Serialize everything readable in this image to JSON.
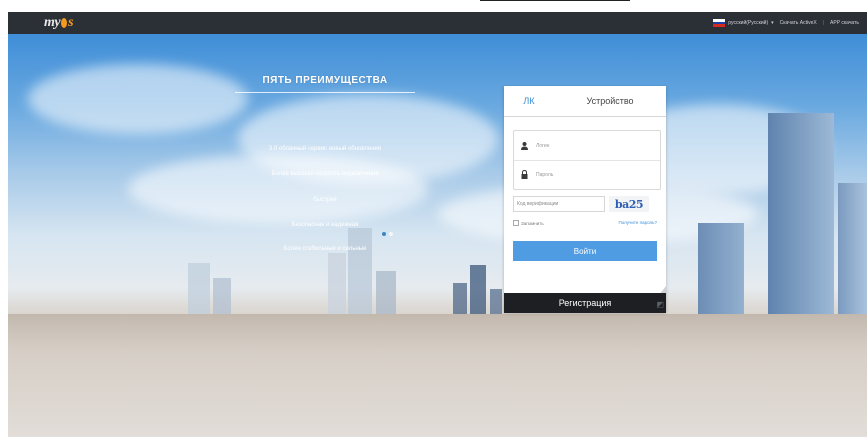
{
  "header": {
    "logo": {
      "main": "my",
      "accent": "s"
    },
    "language": {
      "label": "русский(Русский)",
      "flag": "russia-flag"
    },
    "links": [
      "Скачать ActiveX",
      "APP скачать"
    ]
  },
  "features": {
    "title": "ПЯТЬ ПРЕИМУЩЕСТВА",
    "items": [
      "3.0 облачный сервис новый обновления",
      "Более высокая скорость подключения",
      "быстрее",
      "Безопасная и надежная",
      "Более стабильные и сильные"
    ]
  },
  "login": {
    "tabs": [
      {
        "label": "ЛК",
        "active": true
      },
      {
        "label": "Устройство",
        "active": false
      }
    ],
    "username_placeholder": "Логин",
    "password_placeholder": "Пароль",
    "verify_placeholder": "Код верификации",
    "captcha_text": "ba25",
    "remember_label": "Запомнить",
    "forgot_label": "Получите пароль?",
    "submit_label": "Войти",
    "register_label": "Регистрация"
  },
  "colors": {
    "accent": "#4f9ce3",
    "header_bg": "#2b2f36",
    "logo_orange": "#f29a1f"
  }
}
